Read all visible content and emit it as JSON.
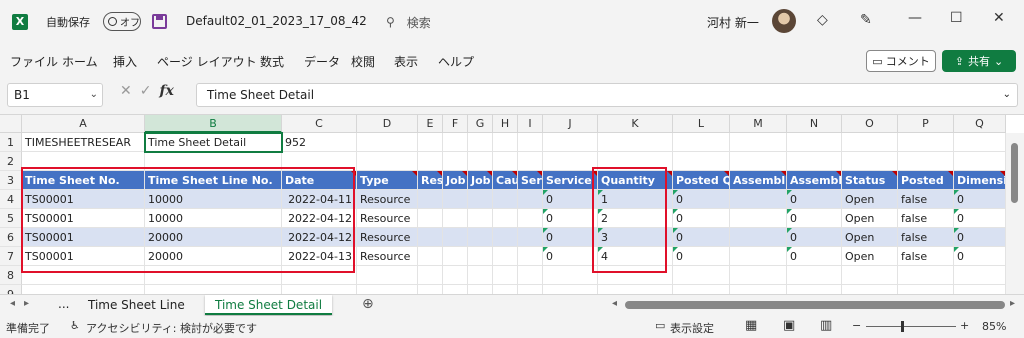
{
  "title": {
    "app_icon": "excel-icon",
    "autosave_label": "自動保存",
    "autosave_state": "オフ",
    "filename": "Default02_01_2023_17_08_42",
    "search_placeholder": "検索",
    "user_name": "河村 新一"
  },
  "menu": [
    "ファイル",
    "ホーム",
    "挿入",
    "ページ レイアウト",
    "数式",
    "データ",
    "校閲",
    "表示",
    "ヘルプ"
  ],
  "buttons": {
    "comment": "コメント",
    "share": "共有"
  },
  "formula_bar": {
    "name_box": "B1",
    "formula": "Time Sheet Detail"
  },
  "columns": [
    "A",
    "B",
    "C",
    "D",
    "E",
    "F",
    "G",
    "H",
    "I",
    "J",
    "K",
    "L",
    "M",
    "N",
    "O",
    "P",
    "Q"
  ],
  "row_numbers": [
    "1",
    "2",
    "3",
    "4",
    "5",
    "6",
    "7",
    "8",
    "9"
  ],
  "row1": {
    "a": "TIMESHEETRESEAR",
    "b": "Time Sheet Detail",
    "c": "952"
  },
  "headers": [
    "Time Sheet No.",
    "Time Sheet Line No.",
    "Date",
    "Type",
    "Res",
    "Job",
    "Job",
    "Cau",
    "Ser",
    "Service",
    "Quantity",
    "Posted Q",
    "Assembl",
    "Assembl",
    "Status",
    "Posted",
    "Dimensi"
  ],
  "rows": [
    [
      "TS00001",
      "10000",
      "2022-04-11",
      "Resource",
      "",
      "",
      "",
      "",
      "",
      "0",
      "1",
      "0",
      "",
      "0",
      "Open",
      "false",
      "0"
    ],
    [
      "TS00001",
      "10000",
      "2022-04-12",
      "Resource",
      "",
      "",
      "",
      "",
      "",
      "0",
      "2",
      "0",
      "",
      "0",
      "Open",
      "false",
      "0"
    ],
    [
      "TS00001",
      "20000",
      "2022-04-12",
      "Resource",
      "",
      "",
      "",
      "",
      "",
      "0",
      "3",
      "0",
      "",
      "0",
      "Open",
      "false",
      "0"
    ],
    [
      "TS00001",
      "20000",
      "2022-04-13",
      "Resource",
      "",
      "",
      "",
      "",
      "",
      "0",
      "4",
      "0",
      "",
      "0",
      "Open",
      "false",
      "0"
    ]
  ],
  "sheets": {
    "more": "...",
    "tab1": "Time Sheet Line",
    "tab2": "Time Sheet Detail"
  },
  "status": {
    "ready": "準備完了",
    "accessibility": "アクセシビリティ: 検討が必要です",
    "display_settings": "表示設定",
    "zoom": "85%"
  }
}
